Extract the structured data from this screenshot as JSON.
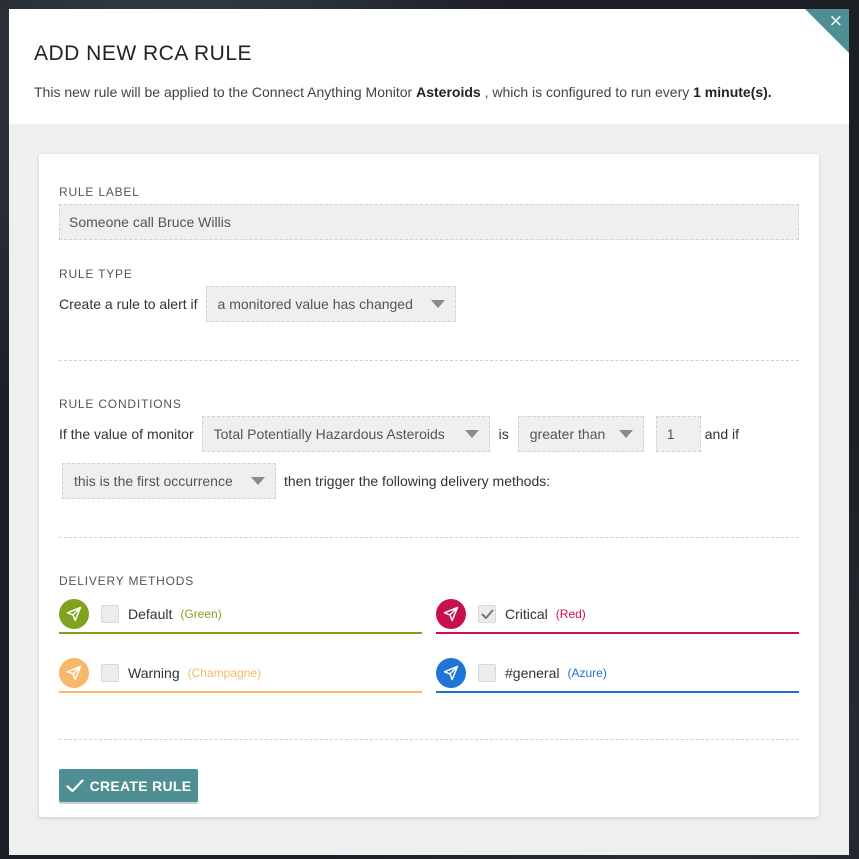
{
  "modal": {
    "title": "ADD NEW RCA RULE",
    "desc_pre": "This new rule will be applied to the Connect Anything Monitor ",
    "monitor_name": "Asteroids",
    "desc_mid": " , which is configured to run every ",
    "interval": "1 minute(s).",
    "close_glyph": "×"
  },
  "rule_label": {
    "label": "RULE LABEL",
    "value": "Someone call Bruce Willis"
  },
  "rule_type": {
    "label": "RULE TYPE",
    "prefix": "Create a rule to alert if",
    "selected": "a monitored value has changed"
  },
  "conditions": {
    "label": "RULE CONDITIONS",
    "prefix": "If the value of monitor",
    "monitor_select": "Total Potentially Hazardous Asteroids",
    "is_text": "is",
    "operator_select": "greater than",
    "threshold": "1",
    "and_if": "and if",
    "occurrence_select": "this is the first occurrence",
    "then_text": "then trigger the following delivery methods:"
  },
  "delivery": {
    "label": "DELIVERY METHODS",
    "methods": [
      {
        "name": "Default",
        "color_name": "(Green)",
        "color": "#7fa31f",
        "checked": false
      },
      {
        "name": "Critical",
        "color_name": "(Red)",
        "color": "#c8104f",
        "checked": true
      },
      {
        "name": "Warning",
        "color_name": "(Champagne)",
        "color": "#f7b86a",
        "checked": false
      },
      {
        "name": "#general",
        "color_name": "(Azure)",
        "color": "#1f74d6",
        "checked": false
      }
    ]
  },
  "submit": {
    "label": "CREATE RULE",
    "color": "#4e8f94"
  }
}
